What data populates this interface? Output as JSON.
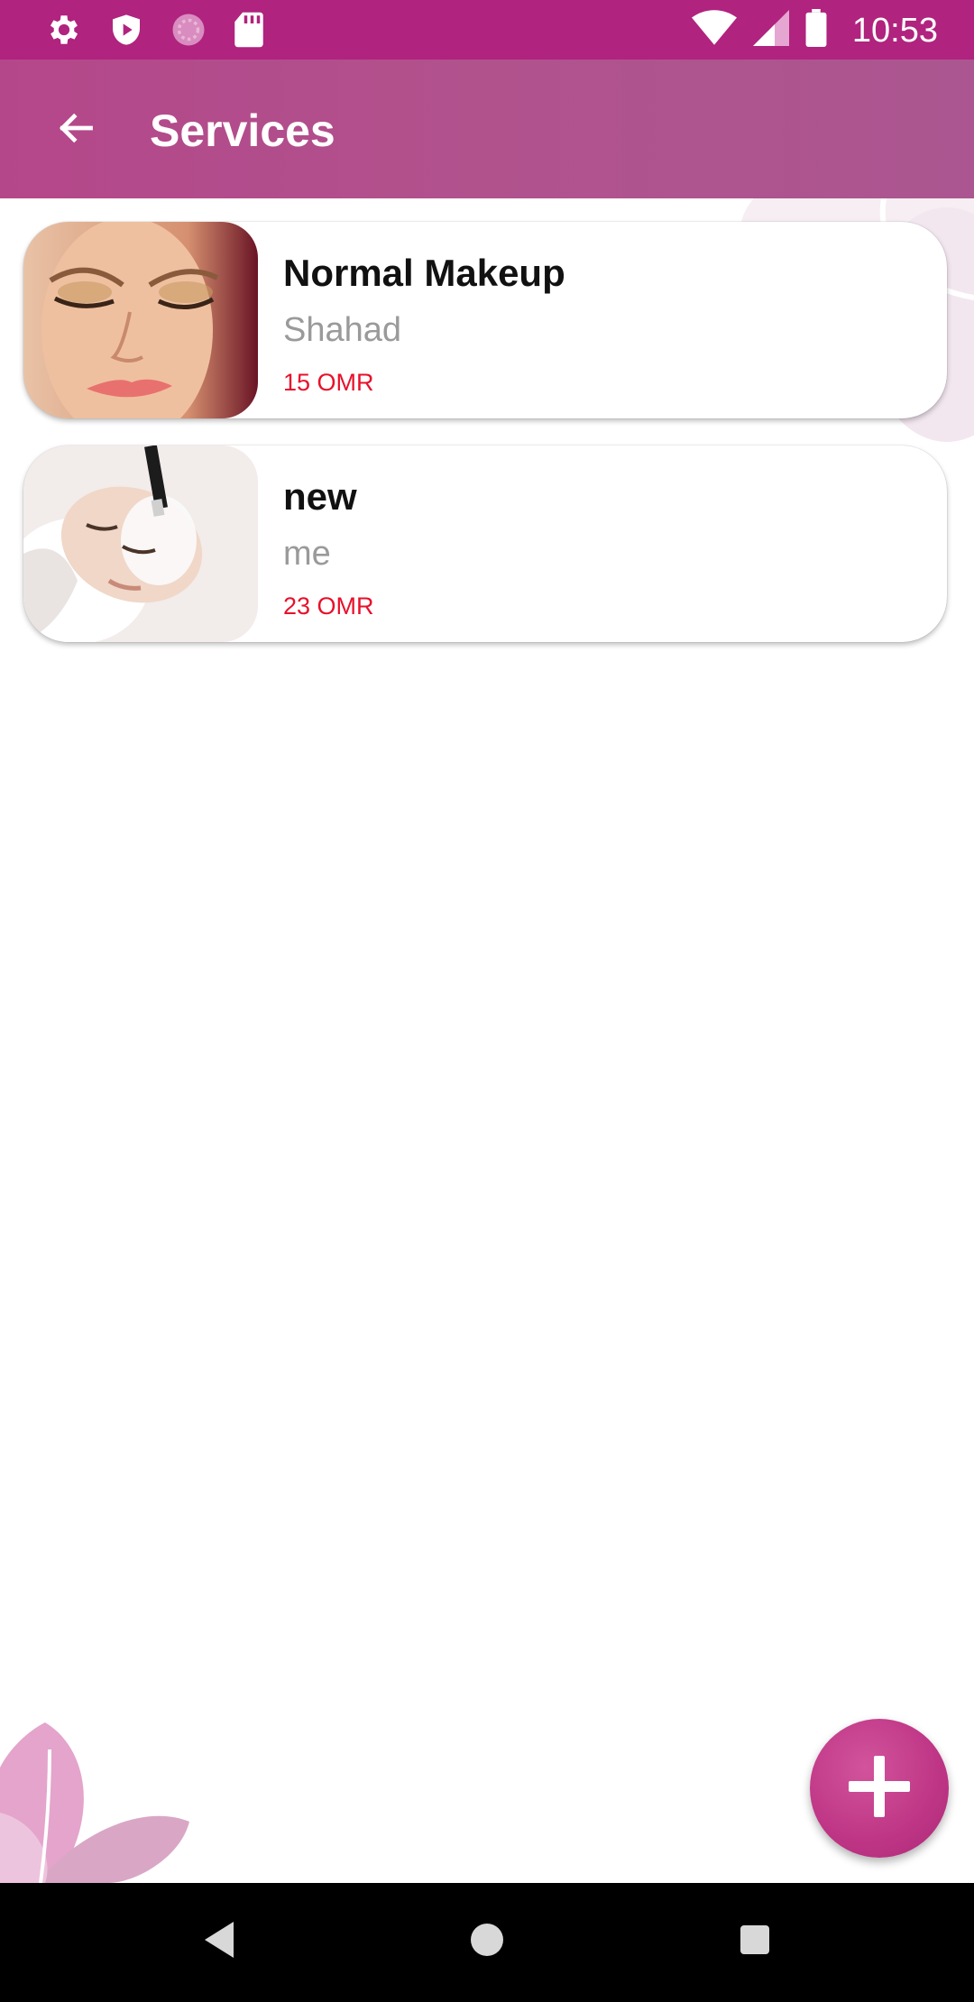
{
  "status_bar": {
    "time": "10:53",
    "left_icons": [
      "settings-icon",
      "shield-play-icon",
      "loading-circle-icon",
      "sd-card-icon"
    ],
    "right_icons": [
      "wifi-icon",
      "cell-signal-icon",
      "battery-icon"
    ]
  },
  "app_bar": {
    "title": "Services",
    "back_icon": "arrow-back-icon"
  },
  "services": [
    {
      "name": "Normal Makeup",
      "provider": "Shahad",
      "price": "15 OMR",
      "image": "makeup-photo"
    },
    {
      "name": "new",
      "provider": "me",
      "price": "23 OMR",
      "image": "facial-mask-photo"
    }
  ],
  "fab": {
    "icon": "plus-icon"
  },
  "nav_bar": {
    "buttons": [
      "back-triangle-icon",
      "home-circle-icon",
      "recents-square-icon"
    ]
  },
  "colors": {
    "status_bar": "#b0237e",
    "app_bar": "#b1508c",
    "price": "#e8102a",
    "provider": "#9a9a9a",
    "fab": "#be3585"
  }
}
